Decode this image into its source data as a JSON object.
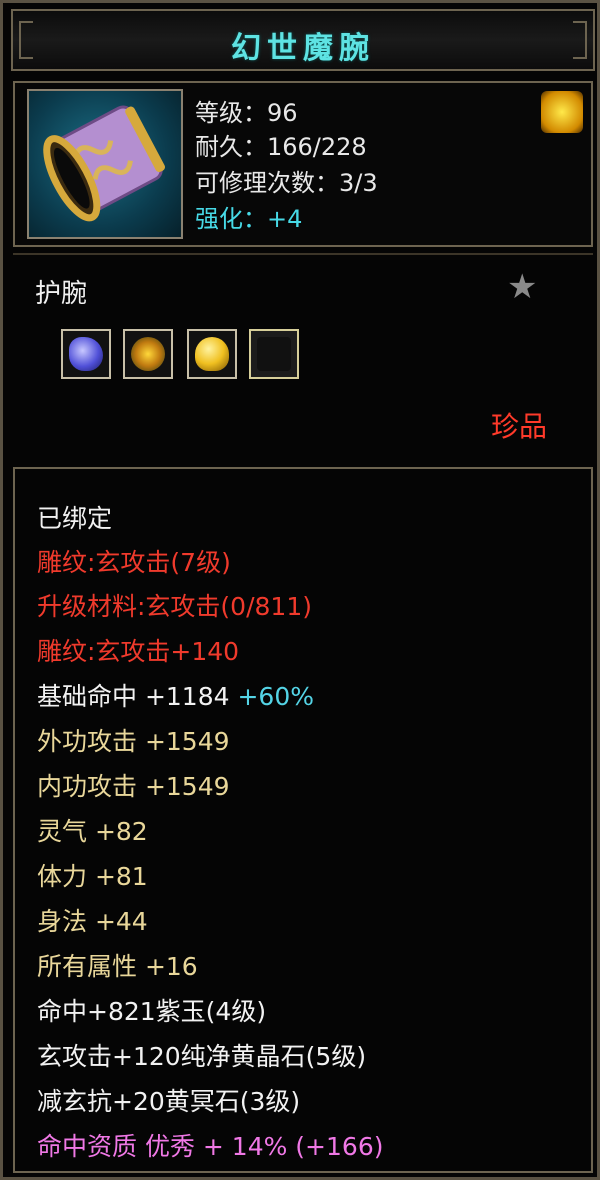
{
  "title": "幻世魔腕",
  "item": {
    "level": "等级：96",
    "durability": "耐久：166/228",
    "repair": "可修理次数：3/3",
    "enhance": "强化：+4",
    "type": "护腕",
    "rarity": "珍品",
    "gems": [
      "purple-gem-icon",
      "yellow-flower-gem-icon",
      "yellow-crystal-gem-icon",
      "empty-socket"
    ]
  },
  "attributes": {
    "bound": "已绑定",
    "engrave1": "雕纹:玄攻击(7级)",
    "upgrade": "升级材料:玄攻击(0/811)",
    "engrave2": "雕纹:玄攻击+140",
    "hit_base": "基础命中  +1184",
    "hit_pct": "+60%",
    "ext_atk": "外功攻击  +1549",
    "int_atk": "内功攻击  +1549",
    "spirit": "灵气  +82",
    "stamina": "体力  +81",
    "agility": "身法  +44",
    "all_attr": "所有属性  +16",
    "gem1": "命中+821紫玉(4级)",
    "gem2": "玄攻击+120纯净黄晶石(5级)",
    "gem3": "减玄抗+20黄冥石(3级)",
    "quality": "命中资质  优秀  +  14%  (+166)"
  },
  "colors": {
    "title": "#5ee3e3",
    "enhance": "#47d9e6",
    "rarity": "#ff3a2a",
    "engrave": "#f03a2c",
    "attr": "#e9d79a",
    "quality": "#f078e6"
  }
}
